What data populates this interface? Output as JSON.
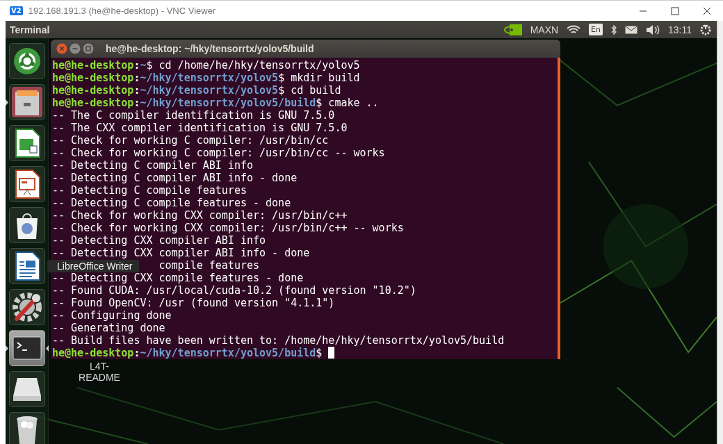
{
  "viewer_window": {
    "title": "192.168.191.3 (he@he-desktop) - VNC Viewer",
    "logo": "V2"
  },
  "top_panel": {
    "app_name": "Terminal",
    "power_mode": "MAXN",
    "keyboard_layout": "En",
    "clock": "13:11"
  },
  "launcher": {
    "items": [
      {
        "kind": "dash",
        "running": false,
        "focused": false
      },
      {
        "kind": "files",
        "running": true,
        "focused": false
      },
      {
        "kind": "calc",
        "running": false,
        "focused": false
      },
      {
        "kind": "impress",
        "running": false,
        "focused": false
      },
      {
        "kind": "software",
        "running": false,
        "focused": false
      },
      {
        "kind": "writer",
        "running": false,
        "focused": false
      },
      {
        "kind": "settings",
        "running": false,
        "focused": false
      },
      {
        "kind": "terminal",
        "running": true,
        "focused": true
      },
      {
        "kind": "drive",
        "running": false,
        "focused": false
      },
      {
        "kind": "trash",
        "running": false,
        "focused": false
      }
    ],
    "tooltip": {
      "text": "LibreOffice Writer"
    }
  },
  "terminal": {
    "title": "he@he-desktop: ~/hky/tensorrtx/yolov5/build",
    "lines": [
      {
        "kind": "prompt",
        "user": "he@he-desktop",
        "separator": ":",
        "path": "~",
        "command": "$ cd /home/he/hky/tensorrtx/yolov5"
      },
      {
        "kind": "prompt",
        "user": "he@he-desktop",
        "separator": ":",
        "path": "~/hky/tensorrtx/yolov5",
        "command": "$ mkdir build"
      },
      {
        "kind": "prompt",
        "user": "he@he-desktop",
        "separator": ":",
        "path": "~/hky/tensorrtx/yolov5",
        "command": "$ cd build"
      },
      {
        "kind": "prompt",
        "user": "he@he-desktop",
        "separator": ":",
        "path": "~/hky/tensorrtx/yolov5/build",
        "command": "$ cmake .."
      },
      {
        "kind": "output",
        "text": "-- The C compiler identification is GNU 7.5.0"
      },
      {
        "kind": "output",
        "text": "-- The CXX compiler identification is GNU 7.5.0"
      },
      {
        "kind": "output",
        "text": "-- Check for working C compiler: /usr/bin/cc"
      },
      {
        "kind": "output",
        "text": "-- Check for working C compiler: /usr/bin/cc -- works"
      },
      {
        "kind": "output",
        "text": "-- Detecting C compiler ABI info"
      },
      {
        "kind": "output",
        "text": "-- Detecting C compiler ABI info - done"
      },
      {
        "kind": "output",
        "text": "-- Detecting C compile features"
      },
      {
        "kind": "output",
        "text": "-- Detecting C compile features - done"
      },
      {
        "kind": "output",
        "text": "-- Check for working CXX compiler: /usr/bin/c++"
      },
      {
        "kind": "output",
        "text": "-- Check for working CXX compiler: /usr/bin/c++ -- works"
      },
      {
        "kind": "output",
        "text": "-- Detecting CXX compiler ABI info"
      },
      {
        "kind": "output",
        "text": "-- Detecting CXX compiler ABI info - done"
      },
      {
        "kind": "covered",
        "text": "compile features"
      },
      {
        "kind": "output",
        "text": "-- Detecting CXX compile features - done"
      },
      {
        "kind": "output",
        "text": "-- Found CUDA: /usr/local/cuda-10.2 (found version \"10.2\")"
      },
      {
        "kind": "output",
        "text": "-- Found OpenCV: /usr (found version \"4.1.1\")"
      },
      {
        "kind": "output",
        "text": "-- Configuring done"
      },
      {
        "kind": "output",
        "text": "-- Generating done"
      },
      {
        "kind": "output",
        "text": "-- Build files have been written to: /home/he/hky/tensorrtx/yolov5/build"
      },
      {
        "kind": "prompt",
        "user": "he@he-desktop",
        "separator": ":",
        "path": "~/hky/tensorrtx/yolov5/build",
        "command": "$ ",
        "cursor": true
      }
    ]
  },
  "desktop_icons": [
    {
      "label": "L4T-README"
    }
  ]
}
